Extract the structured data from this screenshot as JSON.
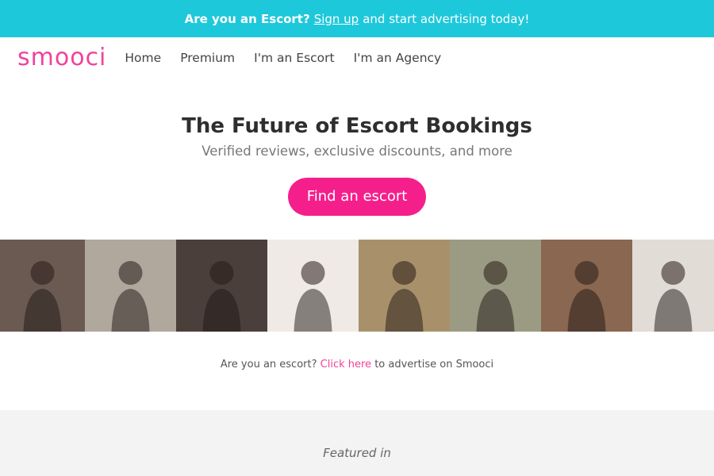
{
  "banner": {
    "prefix": "Are you an Escort?",
    "link": "Sign up",
    "suffix": "and start advertising today!"
  },
  "nav": {
    "logo": "smooci",
    "items": [
      "Home",
      "Premium",
      "I'm an Escort",
      "I'm an Agency"
    ]
  },
  "hero": {
    "title": "The Future of Escort Bookings",
    "subtitle": "Verified reviews, exclusive discounts, and more",
    "cta": "Find an escort"
  },
  "gallery": [
    {
      "name": "escort-photo-1",
      "bg": "#6b5a52"
    },
    {
      "name": "escort-photo-2",
      "bg": "#b0a79d"
    },
    {
      "name": "escort-photo-3",
      "bg": "#4a3f3a"
    },
    {
      "name": "escort-photo-4",
      "bg": "#efeae5"
    },
    {
      "name": "escort-photo-5",
      "bg": "#a8916a"
    },
    {
      "name": "escort-photo-6",
      "bg": "#9a9b82"
    },
    {
      "name": "escort-photo-7",
      "bg": "#8a6750"
    },
    {
      "name": "escort-photo-8",
      "bg": "#e1dcd6"
    }
  ],
  "advertise": {
    "prefix": "Are you an escort?",
    "link": "Click here",
    "suffix": "to advertise on Smooci"
  },
  "featured": {
    "label": "Featured in"
  },
  "colors": {
    "banner": "#1ec8db",
    "brand_pink": "#f0439b",
    "cta": "#f51f8c"
  }
}
